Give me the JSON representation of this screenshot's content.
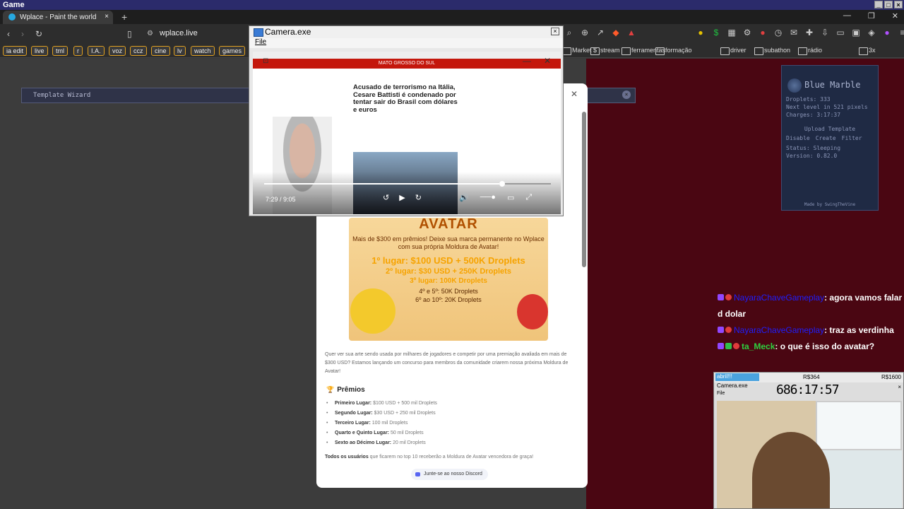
{
  "window": {
    "title": "Game"
  },
  "browser": {
    "tab_title": "Wplace - Paint the world",
    "address": "wplace.live"
  },
  "bookmarks": {
    "chips": [
      "ia edit",
      "live",
      "tml",
      "r",
      "I.A.",
      "voz",
      "ccz",
      "cine",
      "lv",
      "watch",
      "games"
    ],
    "folders": [
      "Market $",
      "stream",
      "ferramentas",
      "formação",
      "driver",
      "subathon",
      "rádio",
      "3x"
    ]
  },
  "wizard": {
    "title": "Template Wizard"
  },
  "blue_marble": {
    "title": "Blue Marble",
    "droplets": "Droplets: 333",
    "next_level": "Next level in 521 pixels",
    "charges": "Charges: 3:17:37",
    "upload": "Upload Template",
    "buttons": [
      "Disable",
      "Create",
      "Filter"
    ],
    "status": "Status: Sleeping",
    "version": "Version: 0.82.0",
    "credit": "Made by SwingTheVine"
  },
  "camera": {
    "title": "Camera.exe",
    "menu": "File",
    "video": {
      "section": "MATO GROSSO DO SUL",
      "headline": "Acusado de terrorismo na Itália, Cesare Battisti é condenado por tentar sair do Brasil com dólares e euros",
      "time": "7:29 / 9:05",
      "progress": 0.82
    }
  },
  "modal": {
    "banner": {
      "title": "AVATAR",
      "line1": "Mais de $300 em prêmios! Deixe sua marca permanente no Wplace com sua própria Moldura de Avatar!",
      "prize1": "1º lugar: $100 USD + 500K Droplets",
      "prize2": "2º lugar: $30 USD + 250K Droplets",
      "prize3": "3º lugar: 100K Droplets",
      "prize4": "4º e 5º: 50K Droplets",
      "prize5": "6º ao 10º: 20K Droplets"
    },
    "description": "Quer ver sua arte sendo usada por milhares de jogadores e competir por uma premiação avaliada em mais de $300 USD? Estamos lançando um concurso para membros da comunidade criarem nossa próxima Moldura de Avatar!",
    "prizes_heading": "Prêmios",
    "prizes": [
      {
        "place": "Primeiro Lugar:",
        "reward": "$100 USD + 500 mil Droplets"
      },
      {
        "place": "Segundo Lugar:",
        "reward": "$30 USD + 250 mil Droplets"
      },
      {
        "place": "Terceiro Lugar:",
        "reward": "100 mil Droplets"
      },
      {
        "place": "Quarto e Quinto Lugar:",
        "reward": "50 mil Droplets"
      },
      {
        "place": "Sexto ao Décimo Lugar:",
        "reward": "20 mil Droplets"
      }
    ],
    "footnote_bold": "Todos os usuários",
    "footnote": "que ficarem no top 10 receberão a Moldura de Avatar vencedora de graça!",
    "discord_button": "Junte-se ao nosso Discord"
  },
  "chat": [
    {
      "user": "NayaraChaveGameplay",
      "message": ": agora vamos falar d dolar"
    },
    {
      "user": "NayaraChaveGameplay",
      "message": ": traz as verdinha"
    },
    {
      "user": "ta_Meck",
      "message": ": o que é isso do avatar?"
    }
  ],
  "small_cam": {
    "strip_left": "abril!!!",
    "strip_mid": "R$364",
    "strip_right": "R$1600",
    "title": "Camera.exe",
    "menu": "File",
    "clock": "686:17:57"
  }
}
